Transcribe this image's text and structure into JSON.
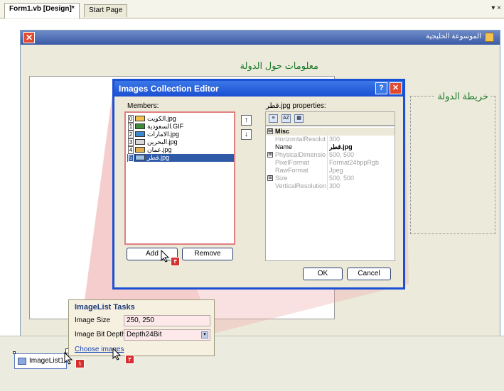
{
  "ide": {
    "tabs": [
      {
        "label": "Form1.vb [Design]*"
      },
      {
        "label": "Start Page"
      }
    ],
    "tab_menu_glyph": "▾ ×"
  },
  "form": {
    "title": "الموسوعة الخليجية",
    "close_glyph": "✕",
    "country_info_label": "معلومات حول الدولة",
    "map_label": "خريطة الدولة"
  },
  "dialog": {
    "title": "Images Collection Editor",
    "help_glyph": "?",
    "close_glyph": "✕",
    "members_label": "Members:",
    "members": [
      {
        "index": "0",
        "name": "الكويت.jpg",
        "thumb_color": "#f2c14e"
      },
      {
        "index": "1",
        "name": "السعودية.GIF",
        "thumb_color": "#3d8a3d"
      },
      {
        "index": "2",
        "name": "الامارات.jpg",
        "thumb_color": "#3a8ad0"
      },
      {
        "index": "3",
        "name": "البحرين.jpg",
        "thumb_color": "#d8d8d8"
      },
      {
        "index": "4",
        "name": "عمان.jpg",
        "thumb_color": "#e0b050"
      },
      {
        "index": "5",
        "name": "قطر.jpg",
        "thumb_color": "#9fc0e6",
        "selected": true
      }
    ],
    "move_up_glyph": "↑",
    "move_down_glyph": "↓",
    "add_label": "Add",
    "remove_label": "Remove",
    "properties_title": "قطر.jpg properties:",
    "toolbar_icons": [
      "categorized-icon",
      "alphabetical-icon",
      "property-pages-icon"
    ],
    "toolbar_glyphs": [
      "≡",
      "AZ",
      "▦"
    ],
    "properties": [
      {
        "kind": "category",
        "name": "Misc",
        "expander": "⊟"
      },
      {
        "kind": "prop",
        "name": "HorizontalResolut",
        "value": "300",
        "dim": true
      },
      {
        "kind": "prop",
        "name": "Name",
        "value": "قطر.jpg",
        "dim": false
      },
      {
        "kind": "prop",
        "name": "PhysicalDimensio",
        "value": "500, 500",
        "dim": true,
        "expander": "⊞"
      },
      {
        "kind": "prop",
        "name": "PixelFormat",
        "value": "Format24bppRgb",
        "dim": true
      },
      {
        "kind": "prop",
        "name": "RawFormat",
        "value": "Jpeg",
        "dim": true
      },
      {
        "kind": "prop",
        "name": "Size",
        "value": "500, 500",
        "dim": true,
        "expander": "⊞"
      },
      {
        "kind": "prop",
        "name": "VerticalResolution",
        "value": "300",
        "dim": true
      }
    ],
    "ok_label": "OK",
    "cancel_label": "Cancel"
  },
  "tasks": {
    "title": "ImageList Tasks",
    "image_size_label": "Image Size",
    "image_size_value": "250, 250",
    "bit_depth_label": "Image Bit Depth",
    "bit_depth_value": "Depth24Bit",
    "select_glyph": "▾",
    "choose_images_link": "Choose images"
  },
  "tray": {
    "component_label": "ImageList1"
  },
  "annotations": {
    "step_badges": [
      "٣",
      "٢",
      "١"
    ],
    "highlight_color": "#e89090"
  }
}
